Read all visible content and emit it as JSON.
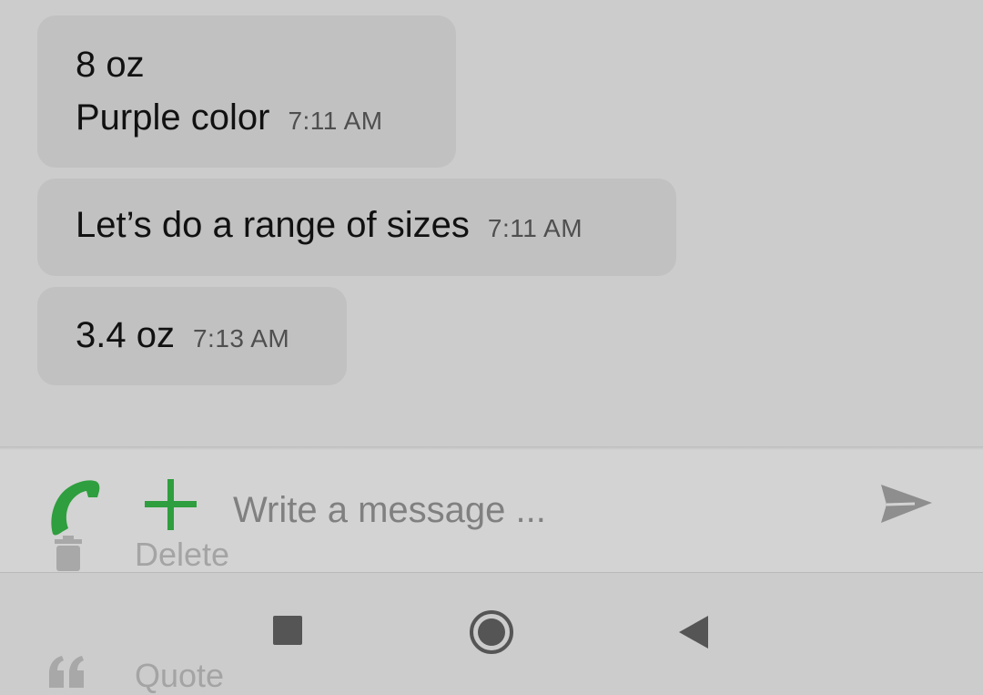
{
  "messages": [
    {
      "lines": [
        "8 oz",
        "Purple color"
      ],
      "time": "7:11 AM"
    },
    {
      "lines": [
        "Let’s do a range of sizes"
      ],
      "time": "7:11 AM"
    },
    {
      "lines": [
        "3.4 oz"
      ],
      "time": "7:13 AM"
    }
  ],
  "composer": {
    "placeholder": "Write a message ...",
    "icons": {
      "call": "phone-icon",
      "attach": "plus-icon",
      "send": "send-icon"
    },
    "accent_color": "#2e9e3e"
  },
  "context_menu": {
    "items": [
      {
        "label": "Delete",
        "icon": "trash-icon"
      },
      {
        "label": "Quote",
        "icon": "quote-icon"
      }
    ]
  },
  "nav": {
    "icons": [
      "recents-square-icon",
      "home-circle-icon",
      "back-triangle-icon"
    ]
  }
}
